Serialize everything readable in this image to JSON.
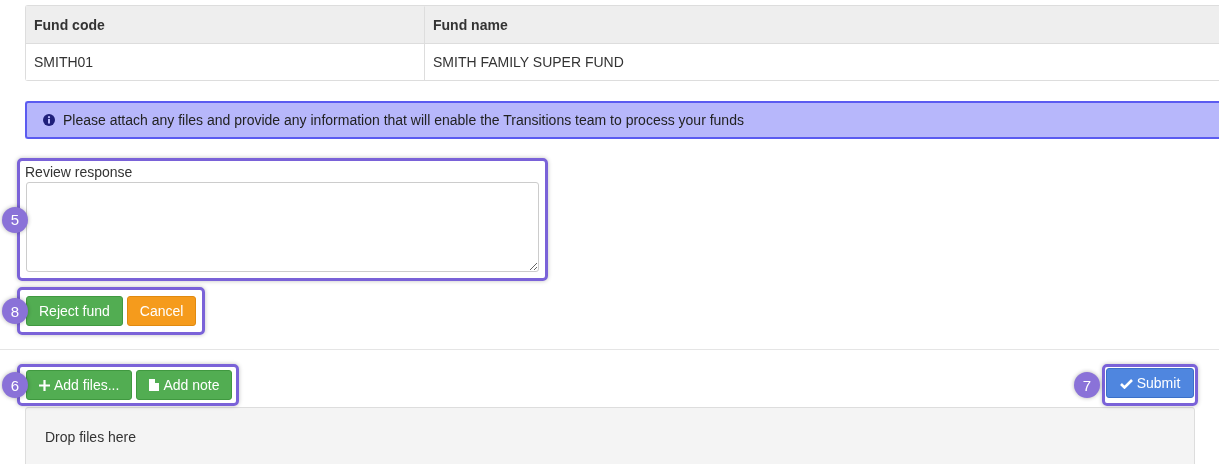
{
  "table": {
    "columns": [
      "Fund code",
      "Fund name"
    ],
    "rows": [
      [
        "SMITH01",
        "SMITH FAMILY SUPER FUND"
      ]
    ]
  },
  "alert": {
    "text": "Please attach any files and provide any information that will enable the Transitions team to process your funds"
  },
  "review": {
    "callout": "5",
    "label": "Review response"
  },
  "review_actions": {
    "callout": "8",
    "buttons": [
      {
        "label": "Reject fund",
        "kind": "success"
      },
      {
        "label": "Cancel",
        "kind": "warning"
      }
    ]
  },
  "file_actions": {
    "callout": "6",
    "buttons": [
      {
        "label": "Add files...",
        "kind": "plus"
      },
      {
        "label": "Add note",
        "kind": "file"
      }
    ]
  },
  "submit": {
    "callout": "7",
    "label": "Submit"
  },
  "dropzone": {
    "text": "Drop files here"
  }
}
